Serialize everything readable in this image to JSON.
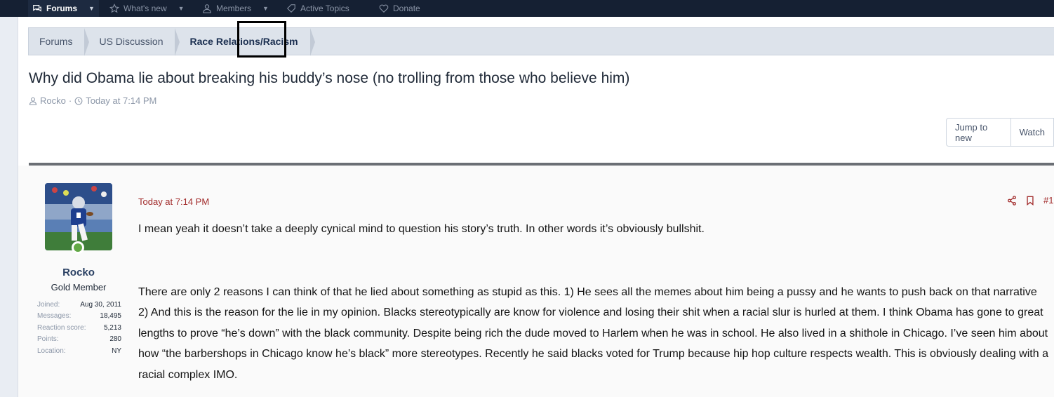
{
  "nav": {
    "items": [
      {
        "label": "Forums",
        "icon": "chat-icon",
        "active": true
      },
      {
        "label": "What's new",
        "icon": "star-icon",
        "active": false
      },
      {
        "label": "Members",
        "icon": "user-icon",
        "active": false
      },
      {
        "label": "Active Topics",
        "icon": "tag-icon",
        "active": false
      },
      {
        "label": "Donate",
        "icon": "heart-icon",
        "active": false
      }
    ]
  },
  "breadcrumb": [
    "Forums",
    "US Discussion",
    "Race Relations/Racism"
  ],
  "thread": {
    "title": "Why did Obama lie about breaking his buddy’s nose (no trolling from those who believe him)",
    "author": "Rocko",
    "separator": "·",
    "date": "Today at 7:14 PM"
  },
  "buttons": {
    "jump_to_new": "Jump to new",
    "watch": "Watch"
  },
  "post": {
    "user": {
      "name": "Rocko",
      "title": "Gold Member",
      "stats": [
        {
          "label": "Joined:",
          "value": "Aug 30, 2011"
        },
        {
          "label": "Messages:",
          "value": "18,495"
        },
        {
          "label": "Reaction score:",
          "value": "5,213"
        },
        {
          "label": "Points:",
          "value": "280"
        },
        {
          "label": "Location:",
          "value": "NY"
        }
      ]
    },
    "date": "Today at 7:14 PM",
    "number": "#1",
    "paragraphs": [
      "I mean yeah it doesn’t take a deeply cynical mind to question his story’s truth. In other words it’s obviously bullshit.",
      "There are only 2 reasons I can think of that he lied about something as stupid as this. 1) He sees all the memes about him being a pussy and he wants to push back on that narrative",
      "2) And this is the reason for the lie in my opinion. Blacks stereotypically are know for violence and losing their shit when a racial slur is hurled at them. I think Obama has gone to great lengths to prove “he’s down” with the black community. Despite being rich the dude moved to Harlem when he was in school. He also lived in a shithole in Chicago. I’ve seen him about how “the barbershops in Chicago know he’s black” more stereotypes. Recently he said blacks voted for Trump because hip hop culture respects wealth. This is obviously dealing with a racial complex IMO."
    ]
  },
  "colors": {
    "nav_bg": "#152033",
    "accent_red": "#a12a2a",
    "username": "#2a4063",
    "online": "#62a846"
  }
}
